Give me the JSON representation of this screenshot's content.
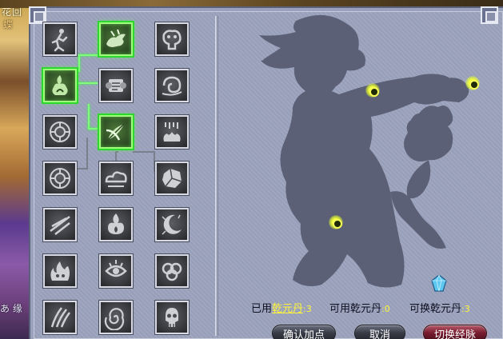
{
  "background_scene": {
    "text_top": "花回",
    "text_top2": "蝶",
    "text_bottom": "あ 缘"
  },
  "skill_grid": {
    "rows": [
      [
        {
          "icon": "running-figure-icon",
          "active": false
        },
        {
          "icon": "dragon-mount-icon",
          "active": true
        },
        {
          "icon": "beast-head-icon",
          "active": false
        }
      ],
      [
        {
          "icon": "flame-aura-icon",
          "active": true
        },
        {
          "icon": "scroll-icon",
          "active": false
        },
        {
          "icon": "swirl-wind-icon",
          "active": false
        }
      ],
      [
        {
          "icon": "bagua-disc-icon",
          "active": false
        },
        {
          "icon": "crossed-feathers-icon",
          "active": true
        },
        {
          "icon": "fire-rain-icon",
          "active": false
        }
      ],
      [
        {
          "icon": "bagua-disc-icon",
          "active": false
        },
        {
          "icon": "cloud-mist-icon",
          "active": false
        },
        {
          "icon": "rock-armor-icon",
          "active": false
        }
      ],
      [
        {
          "icon": "slash-strike-icon",
          "active": false
        },
        {
          "icon": "fire-burst-icon",
          "active": false
        },
        {
          "icon": "crescent-moon-icon",
          "active": false
        }
      ],
      [
        {
          "icon": "demon-flame-icon",
          "active": false
        },
        {
          "icon": "flaming-eye-icon",
          "active": false
        },
        {
          "icon": "cloud-knot-icon",
          "active": false
        }
      ],
      [
        {
          "icon": "claw-slash-icon",
          "active": false
        },
        {
          "icon": "spiral-shell-icon",
          "active": false
        },
        {
          "icon": "spirit-skull-icon",
          "active": false
        }
      ]
    ]
  },
  "character_panel": {
    "silhouette": "character-silhouette-with-monkey",
    "acupoints": 3
  },
  "stats": {
    "used_label": "已用",
    "used_item": "乾元丹",
    "used_value": "3",
    "available_label": "可用乾元丹",
    "available_value": "0",
    "exchangeable_label": "可换乾元丹",
    "exchangeable_value": "3"
  },
  "buttons": {
    "confirm": "确认加点",
    "cancel": "取消",
    "switch": "切换经脉"
  },
  "colors": {
    "panel_bg": "#9ca3be",
    "silhouette": "#5b6076",
    "active_glow": "#5cff3a",
    "highlight_text": "#fff63a",
    "switch_button": "#7a1e30"
  }
}
